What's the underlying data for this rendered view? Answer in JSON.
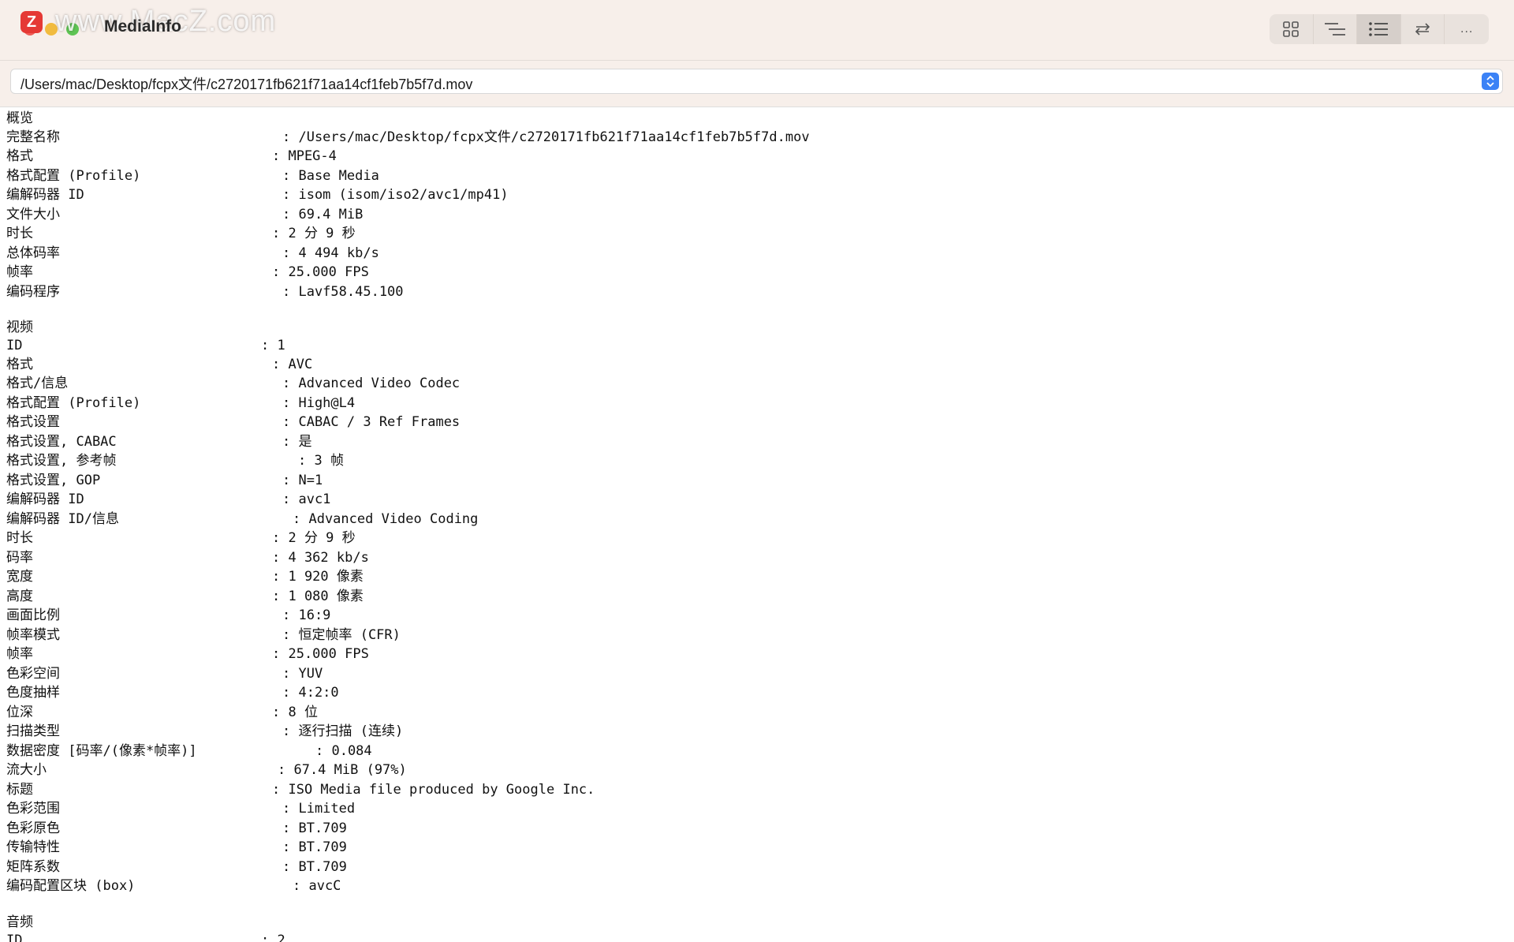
{
  "watermark": {
    "badge": "Z",
    "text": "www.MacZ.com"
  },
  "window": {
    "title": "MediaInfo",
    "toolbar": {
      "buttons": [
        {
          "icon": "grid-icon",
          "active": false
        },
        {
          "icon": "tree-list-icon",
          "active": false
        },
        {
          "icon": "bullet-list-icon",
          "active": true
        },
        {
          "icon": "swap-arrows-icon",
          "active": false
        },
        {
          "icon": "more-icon",
          "label": "...",
          "active": false
        }
      ]
    }
  },
  "path": {
    "value": "/Users/mac/Desktop/fcpx文件/c2720171fb621f71aa14cf1feb7b5f7d.mov"
  },
  "report": {
    "general": {
      "header": "概览",
      "rows": [
        {
          "label": "完整名称",
          "value": ": /Users/mac/Desktop/fcpx文件/c2720171fb621f71aa14cf1feb7b5f7d.mov"
        },
        {
          "label": "格式",
          "value": ": MPEG-4"
        },
        {
          "label": "格式配置 (Profile)",
          "value": ": Base Media"
        },
        {
          "label": "编解码器 ID",
          "value": ": isom (isom/iso2/avc1/mp41)"
        },
        {
          "label": "文件大小",
          "value": ": 69.4 MiB"
        },
        {
          "label": "时长",
          "value": ": 2 分 9 秒"
        },
        {
          "label": "总体码率",
          "value": ": 4 494 kb/s"
        },
        {
          "label": "帧率",
          "value": ": 25.000 FPS"
        },
        {
          "label": "编码程序",
          "value": ": Lavf58.45.100"
        }
      ]
    },
    "video": {
      "header": "视频",
      "rows": [
        {
          "label": "ID",
          "value": ": 1"
        },
        {
          "label": "格式",
          "value": ": AVC"
        },
        {
          "label": "格式/信息",
          "value": ": Advanced Video Codec"
        },
        {
          "label": "格式配置 (Profile)",
          "value": ": High@L4"
        },
        {
          "label": "格式设置",
          "value": ": CABAC / 3 Ref Frames"
        },
        {
          "label": "格式设置, CABAC",
          "value": ": 是"
        },
        {
          "label": "格式设置, 参考帧",
          "value": ": 3 帧"
        },
        {
          "label": "格式设置, GOP",
          "value": ": N=1"
        },
        {
          "label": "编解码器 ID",
          "value": ": avc1"
        },
        {
          "label": "编解码器 ID/信息",
          "value": ": Advanced Video Coding"
        },
        {
          "label": "时长",
          "value": ": 2 分 9 秒"
        },
        {
          "label": "码率",
          "value": ": 4 362 kb/s"
        },
        {
          "label": "宽度",
          "value": ": 1 920 像素"
        },
        {
          "label": "高度",
          "value": ": 1 080 像素"
        },
        {
          "label": "画面比例",
          "value": ": 16:9"
        },
        {
          "label": "帧率模式",
          "value": ": 恒定帧率 (CFR)"
        },
        {
          "label": "帧率",
          "value": ": 25.000 FPS"
        },
        {
          "label": "色彩空间",
          "value": ": YUV"
        },
        {
          "label": "色度抽样",
          "value": ": 4:2:0"
        },
        {
          "label": "位深",
          "value": ": 8 位"
        },
        {
          "label": "扫描类型",
          "value": ": 逐行扫描 (连续)"
        },
        {
          "label": "数据密度 [码率/(像素*帧率)]",
          "value": ": 0.084"
        },
        {
          "label": "流大小",
          "value": ": 67.4 MiB (97%)"
        },
        {
          "label": "标题",
          "value": ": ISO Media file produced by Google Inc."
        },
        {
          "label": "色彩范围",
          "value": ": Limited"
        },
        {
          "label": "色彩原色",
          "value": ": BT.709"
        },
        {
          "label": "传输特性",
          "value": ": BT.709"
        },
        {
          "label": "矩阵系数",
          "value": ": BT.709"
        },
        {
          "label": "编码配置区块 (box)",
          "value": ": avcC"
        }
      ]
    },
    "audio": {
      "header": "音频",
      "rows": [
        {
          "label": "ID",
          "value": ": 2"
        }
      ]
    }
  }
}
